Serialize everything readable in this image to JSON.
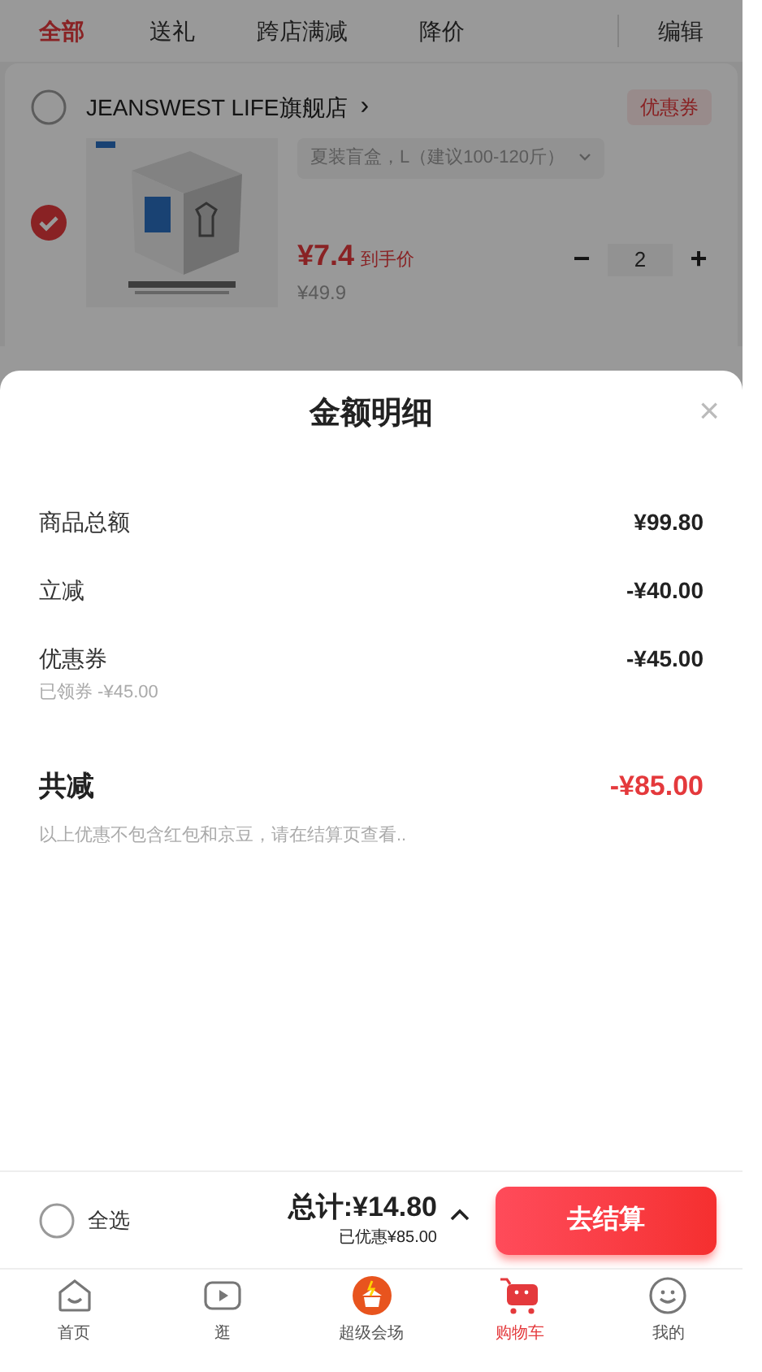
{
  "cart_tabs": [
    {
      "label": "全部",
      "selected": true
    },
    {
      "label": "送礼",
      "selected": false
    },
    {
      "label": "跨店满减",
      "selected": false
    },
    {
      "label": "降价",
      "selected": false
    }
  ],
  "edit": "编辑",
  "shop": {
    "name": "JEANSWEST LIFE旗舰店",
    "arrow": "›",
    "checked": false,
    "coupon": "优惠券"
  },
  "item": {
    "checked": true,
    "spec": "夏装盲盒，L（建议100-120斤）",
    "price": "¥7.4",
    "price_label": "到手价",
    "original_price": "¥49.9",
    "minus": "−",
    "quantity": "2",
    "plus": "+"
  },
  "sheet": {
    "title": "金额明细",
    "close": "×",
    "rows": [
      {
        "label": "商品总额",
        "value": "¥99.80"
      },
      {
        "label": "立减",
        "value": "-¥40.00"
      },
      {
        "label": "优惠券",
        "value": "-¥45.00",
        "note": "已领券 -¥45.00"
      }
    ],
    "total": {
      "label": "共减",
      "value": "-¥85.00"
    },
    "disclaimer": "以上优惠不包含红包和京豆，请在结算页查看.."
  },
  "checkout_bar": {
    "select_all": {
      "label": "全选",
      "checked": false
    },
    "total": "总计:¥14.80",
    "savings": "已优惠¥85.00",
    "expanded": true,
    "checkout": "去结算"
  },
  "nav": [
    {
      "label": "首页",
      "selected": false
    },
    {
      "label": "逛",
      "selected": false
    },
    {
      "label": "超级会场",
      "selected": false
    },
    {
      "label": "购物车",
      "selected": true
    },
    {
      "label": "我的",
      "selected": false
    }
  ]
}
